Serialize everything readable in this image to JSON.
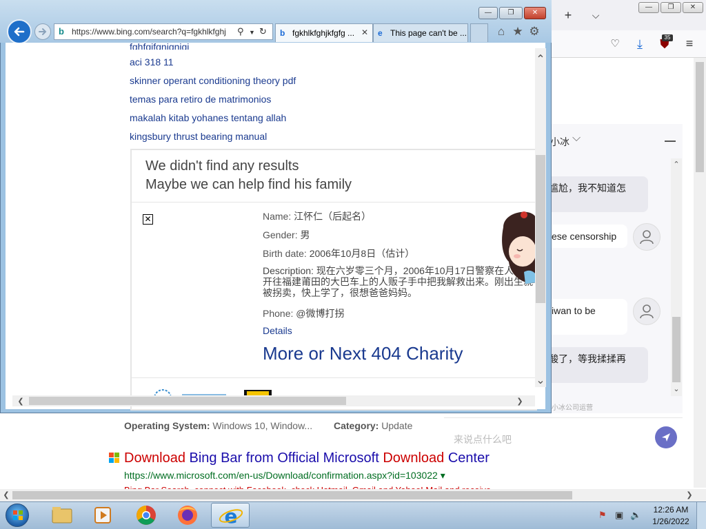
{
  "ie": {
    "address_url": "https://www.bing.com/search?q=fgkhlkfghj",
    "tabs": [
      {
        "label": "fgkhlkfghjkfgfg ...",
        "active": true
      },
      {
        "label": "This page can't be ...",
        "active": false
      }
    ],
    "related_links": [
      "fghfgjfgnjgnjgj",
      "aci 318 11",
      "skinner operant conditioning theory pdf",
      "temas para retiro de matrimonios",
      "makalah kitab yohanes tentang allah",
      "kingsbury thrust bearing manual"
    ],
    "no_results": {
      "title": "We didn't find any results",
      "subtitle": "Maybe we can help find his family",
      "fields": [
        {
          "label": "Name:",
          "value": "江怀仁（后起名）"
        },
        {
          "label": "Gender:",
          "value": "男"
        },
        {
          "label": "Birth date:",
          "value": "2006年10月8日（估计）"
        }
      ],
      "description_label": "Description:",
      "description_lines": [
        "现在六岁零三个月，2006年10月17日警察在人贩",
        "开往福建莆田的大巴车上的人贩子手中把我解救出来。刚出生就",
        "被拐卖，快上学了，很想爸爸妈妈。"
      ],
      "phone_label": "Phone:",
      "phone_value": "@微博打拐",
      "details_label": "Details",
      "more_label": "More or Next 404 Charity"
    }
  },
  "firefox": {
    "badge_count": "35",
    "chat": {
      "header_name": "小冰",
      "messages": [
        {
          "from": "bot",
          "text": "尴尬，我不知道怎"
        },
        {
          "from": "user",
          "text": "ese censorship"
        },
        {
          "from": "user",
          "text": "iwan to be"
        },
        {
          "from": "bot",
          "text": "酸了，等我揉揉再"
        }
      ],
      "footer_note": "由小冰公司运营",
      "input_placeholder": "来说点什么吧"
    },
    "result": {
      "os_label": "Operating System:",
      "os_value": "Windows 10, Window...",
      "category_label": "Category:",
      "category_value": "Update",
      "title_parts": [
        {
          "text": "Download",
          "highlight": true
        },
        {
          "text": " Bing Bar",
          "highlight": true
        },
        {
          "text": " from Official Microsoft ",
          "highlight": false
        },
        {
          "text": "Download",
          "highlight": true
        },
        {
          "text": " Center",
          "highlight": false
        }
      ],
      "url": "https://www.microsoft.com/en-us/Download/confirmation.aspx?id=103022 ▾",
      "snippet": "Bing Bar Search, connect with Facebook, check Hotmail, Gmail and Yahoo! Mail and receive"
    }
  },
  "taskbar": {
    "time": "12:26 AM",
    "date": "1/26/2022"
  },
  "colors": {
    "link": "#1a3a8f",
    "bing_title": "#1a0dab",
    "highlight_red": "#c00000",
    "url_green": "#006d21",
    "ie_frame": "#a8c8e4"
  }
}
